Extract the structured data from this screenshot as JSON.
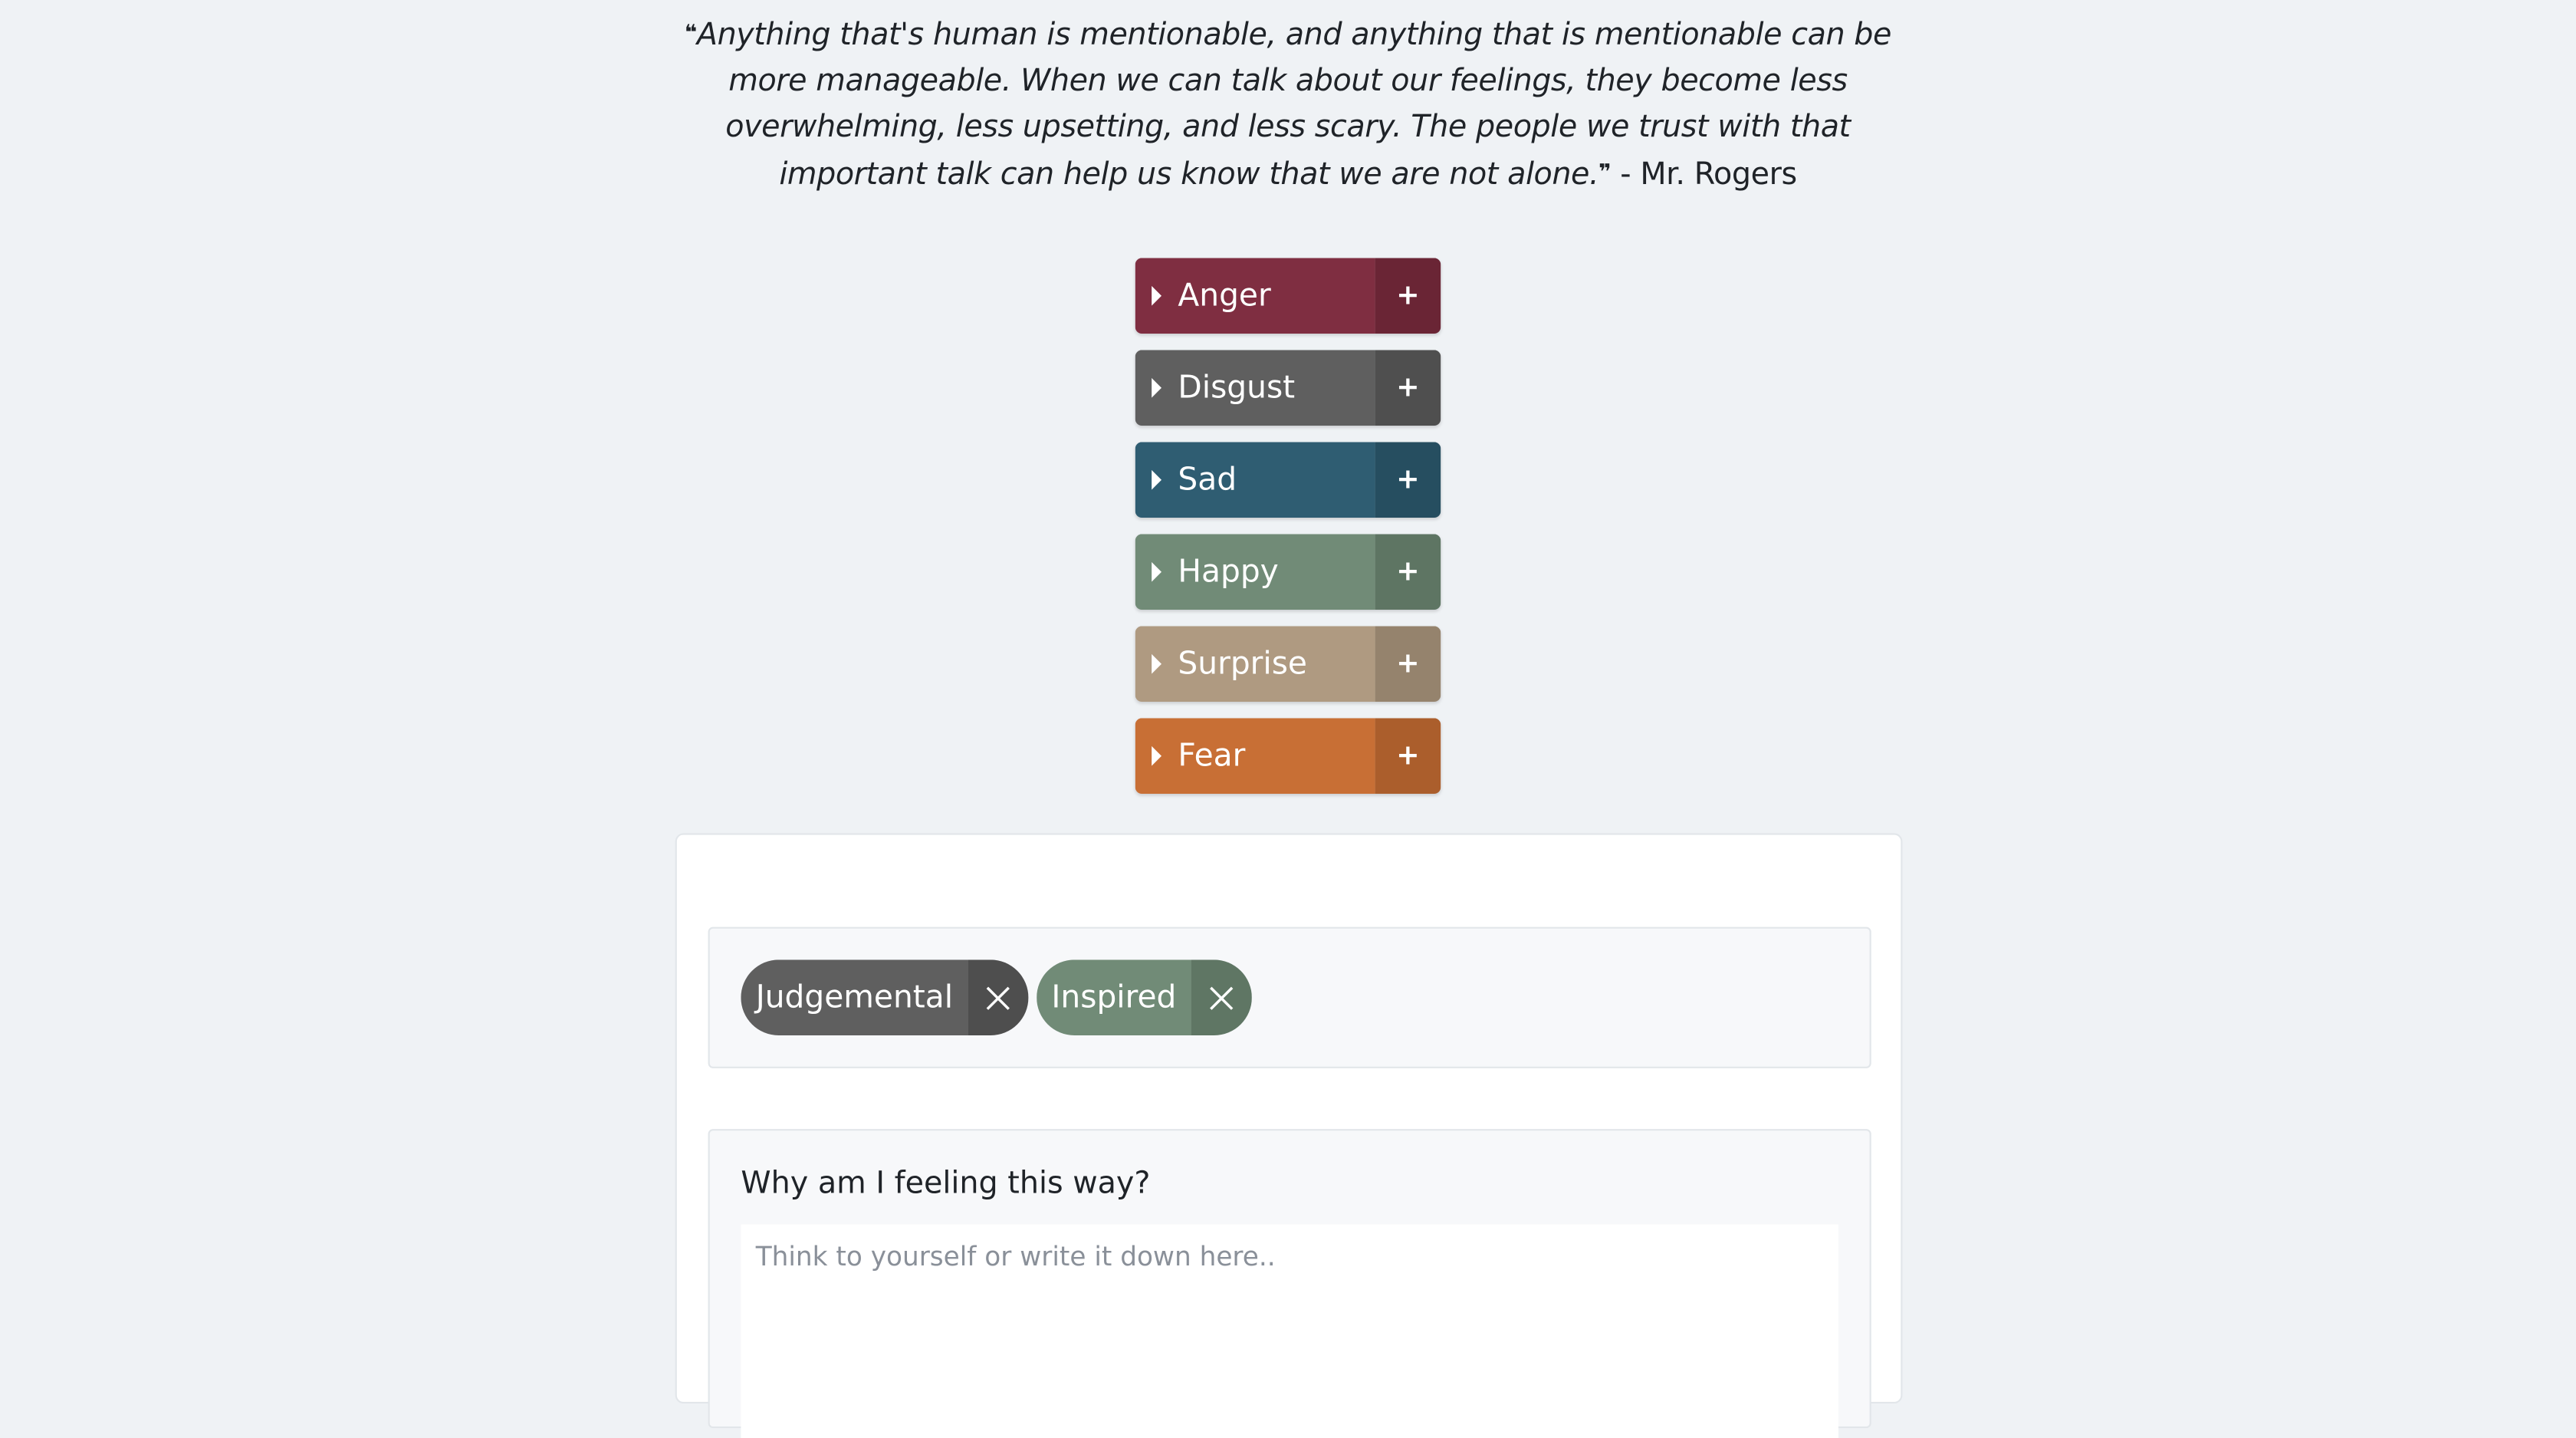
{
  "quote": {
    "text": "Anything that's human is mentionable, and anything that is mentionable can be more manageable. When we can talk about our feelings, they become less overwhelming, less upsetting, and less scary. The people we trust with that important talk can help us know that we are not alone.",
    "open_mark": "❝",
    "close_mark": "❞",
    "author": " - Mr. Rogers"
  },
  "emotions": [
    {
      "label": "Anger",
      "plus": "+",
      "color": "#7f2e41",
      "plus_color": "#6a2535"
    },
    {
      "label": "Disgust",
      "plus": "+",
      "color": "#5f5f5f",
      "plus_color": "#4f4f4f"
    },
    {
      "label": "Sad",
      "plus": "+",
      "color": "#2f5d72",
      "plus_color": "#264e60"
    },
    {
      "label": "Happy",
      "plus": "+",
      "color": "#718b77",
      "plus_color": "#5e7563"
    },
    {
      "label": "Surprise",
      "plus": "+",
      "color": "#af9a81",
      "plus_color": "#95836d"
    },
    {
      "label": "Fear",
      "plus": "+",
      "color": "#c86f35",
      "plus_color": "#ab5e2c"
    }
  ],
  "selected_tags": [
    {
      "label": "Judgemental",
      "color": "#5f5f5f",
      "x_color": "#4e4e4e"
    },
    {
      "label": "Inspired",
      "color": "#718b77",
      "x_color": "#5f7664"
    }
  ],
  "reflection": {
    "label": "Why am I feeling this way?",
    "placeholder": "Think to yourself or write it down here..",
    "value": ""
  }
}
